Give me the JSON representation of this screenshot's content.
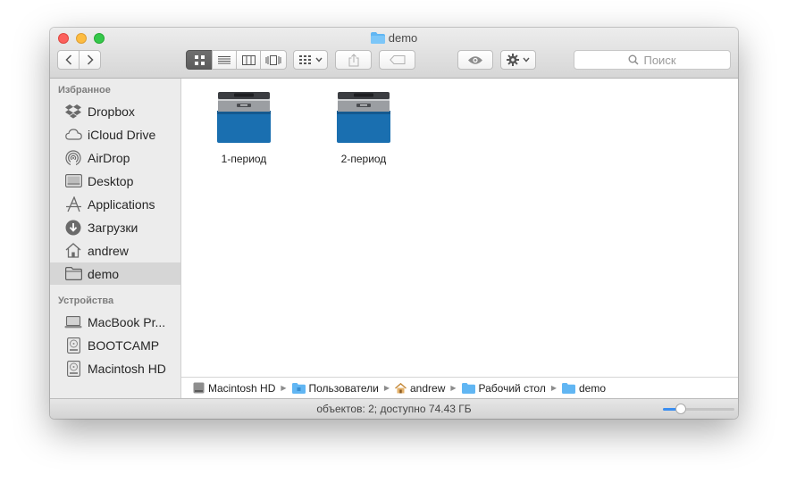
{
  "window": {
    "title": "demo",
    "colors": {
      "close": "#fc605c",
      "minimize": "#fdbc40",
      "maximize": "#34c84a",
      "folder": "#61b6f3",
      "accent": "#3b8ef0"
    }
  },
  "toolbar": {
    "back_icon": "chevron-left-icon",
    "forward_icon": "chevron-right-icon",
    "view_modes": [
      "icon-view-icon",
      "list-view-icon",
      "column-view-icon",
      "cover-flow-icon"
    ],
    "active_view": "icon-view-icon",
    "arrange_icon": "arrange-grid-icon",
    "share_icon": "share-icon",
    "tag_icon": "tag-icon",
    "quicklook_icon": "eye-icon",
    "action_icon": "gear-icon",
    "search_placeholder": "Поиск"
  },
  "sidebar": {
    "favorites_heading": "Избранное",
    "favorites": [
      {
        "label": "Dropbox",
        "icon": "dropbox-icon"
      },
      {
        "label": "iCloud Drive",
        "icon": "cloud-icon"
      },
      {
        "label": "AirDrop",
        "icon": "airdrop-icon"
      },
      {
        "label": "Desktop",
        "icon": "desktop-icon"
      },
      {
        "label": "Applications",
        "icon": "applications-icon"
      },
      {
        "label": "Загрузки",
        "icon": "download-icon"
      },
      {
        "label": "andrew",
        "icon": "home-icon"
      },
      {
        "label": "demo",
        "icon": "folder-icon",
        "selected": true
      }
    ],
    "devices_heading": "Устройства",
    "devices": [
      {
        "label": "MacBook Pr...",
        "icon": "laptop-icon"
      },
      {
        "label": "BOOTCAMP",
        "icon": "disk-icon"
      },
      {
        "label": "Macintosh HD",
        "icon": "disk-icon"
      }
    ]
  },
  "files": [
    {
      "name": "1-период",
      "icon": "archive-box-icon"
    },
    {
      "name": "2-период",
      "icon": "archive-box-icon"
    }
  ],
  "pathbar": {
    "crumbs": [
      {
        "label": "Macintosh HD",
        "icon": "disk-icon"
      },
      {
        "label": "Пользователи",
        "icon": "folder-icon"
      },
      {
        "label": "andrew",
        "icon": "home-icon"
      },
      {
        "label": "Рабочий стол",
        "icon": "folder-icon"
      },
      {
        "label": "demo",
        "icon": "folder-icon"
      }
    ]
  },
  "statusbar": {
    "text": "объектов: 2; доступно 74.43 ГБ",
    "icon_size_fraction": 0.25
  }
}
